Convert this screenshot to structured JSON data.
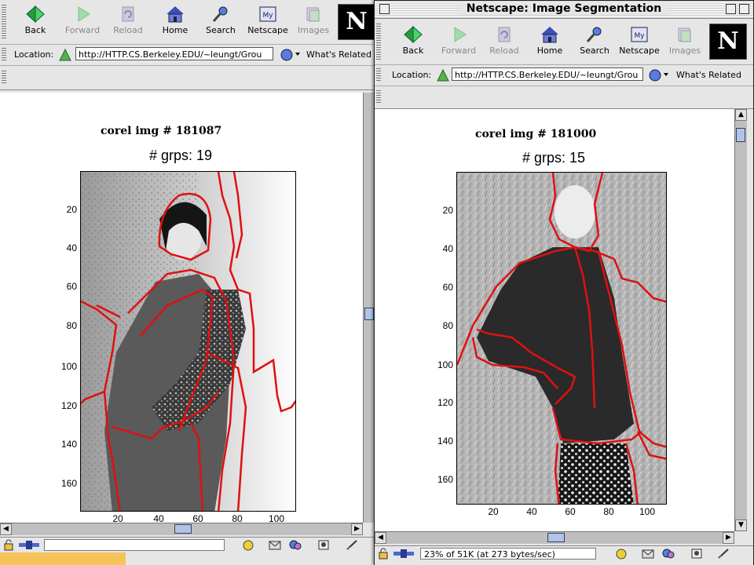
{
  "back_window": {
    "toolbar": [
      {
        "label": "Back",
        "icon": "back-arrow-icon",
        "enabled": true
      },
      {
        "label": "Forward",
        "icon": "forward-arrow-icon",
        "enabled": false
      },
      {
        "label": "Reload",
        "icon": "reload-icon",
        "enabled": false
      },
      {
        "label": "Home",
        "icon": "home-icon",
        "enabled": true
      },
      {
        "label": "Search",
        "icon": "search-icon",
        "enabled": true
      },
      {
        "label": "Netscape",
        "icon": "my-netscape-icon",
        "enabled": true
      },
      {
        "label": "Images",
        "icon": "images-icon",
        "enabled": false
      }
    ],
    "location_label": "Location:",
    "url": "http://HTTP.CS.Berkeley.EDU/~leungt/Grou",
    "related_label": "What's Related",
    "figure": {
      "title": "corel img # 181087",
      "groups": "# grps: 19",
      "yticks": [
        "20",
        "40",
        "60",
        "80",
        "100",
        "120",
        "140",
        "160"
      ],
      "xticks": [
        "20",
        "40",
        "60",
        "80",
        "100"
      ]
    }
  },
  "front_window": {
    "title": "Netscape: Image Segmentation",
    "toolbar": [
      {
        "label": "Back",
        "icon": "back-arrow-icon",
        "enabled": true
      },
      {
        "label": "Forward",
        "icon": "forward-arrow-icon",
        "enabled": false
      },
      {
        "label": "Reload",
        "icon": "reload-icon",
        "enabled": false
      },
      {
        "label": "Home",
        "icon": "home-icon",
        "enabled": true
      },
      {
        "label": "Search",
        "icon": "search-icon",
        "enabled": true
      },
      {
        "label": "Netscape",
        "icon": "my-netscape-icon",
        "enabled": true
      },
      {
        "label": "Images",
        "icon": "images-icon",
        "enabled": false
      }
    ],
    "location_label": "Location:",
    "url": "http://HTTP.CS.Berkeley.EDU/~leungt/Grou",
    "related_label": "What's Related",
    "status": "23% of 51K (at 273 bytes/sec)",
    "figure": {
      "title": "corel img # 181000",
      "groups": "# grps: 15",
      "yticks": [
        "20",
        "40",
        "60",
        "80",
        "100",
        "120",
        "140",
        "160"
      ],
      "xticks": [
        "20",
        "40",
        "60",
        "80",
        "100"
      ]
    }
  },
  "colors": {
    "segment_boundary": "#e01010",
    "chrome": "#e6e6e6",
    "thumb": "#b0c4e8",
    "loading_bar": "#f7c45a"
  }
}
